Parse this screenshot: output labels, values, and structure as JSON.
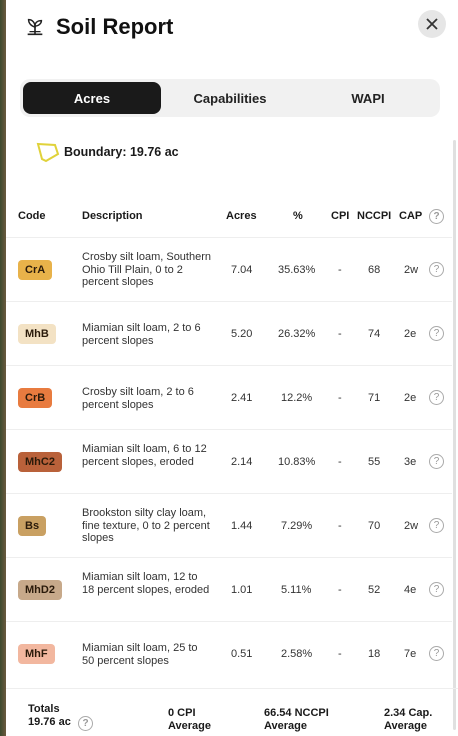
{
  "header": {
    "title": "Soil Report"
  },
  "tabs": [
    {
      "label": "Acres",
      "active": true
    },
    {
      "label": "Capabilities",
      "active": false
    },
    {
      "label": "WAPI",
      "active": false
    }
  ],
  "boundary": {
    "label": "Boundary: 19.76 ac"
  },
  "table": {
    "headers": {
      "code": "Code",
      "description": "Description",
      "acres": "Acres",
      "pct": "%",
      "cpi": "CPI",
      "nccpi": "NCCPI",
      "cap": "CAP"
    },
    "rows": [
      {
        "code": "CrA",
        "color": "#e8b24a",
        "description": "Crosby silt loam, Southern Ohio Till Plain, 0 to 2 percent slopes",
        "acres": "7.04",
        "pct": "35.63%",
        "cpi": "-",
        "nccpi": "68",
        "cap": "2w"
      },
      {
        "code": "MhB",
        "color": "#f3e2c4",
        "description": "Miamian silt loam, 2 to 6 percent slopes",
        "acres": "5.20",
        "pct": "26.32%",
        "cpi": "-",
        "nccpi": "74",
        "cap": "2e"
      },
      {
        "code": "CrB",
        "color": "#e87b3f",
        "description": "Crosby silt loam, 2 to 6 percent slopes",
        "acres": "2.41",
        "pct": "12.2%",
        "cpi": "-",
        "nccpi": "71",
        "cap": "2e"
      },
      {
        "code": "MhC2",
        "color": "#b9613a",
        "description": "Miamian silt loam, 6 to 12 percent slopes, eroded",
        "acres": "2.14",
        "pct": "10.83%",
        "cpi": "-",
        "nccpi": "55",
        "cap": "3e"
      },
      {
        "code": "Bs",
        "color": "#c9a062",
        "description": "Brookston silty clay loam, fine texture, 0 to 2 percent slopes",
        "acres": "1.44",
        "pct": "7.29%",
        "cpi": "-",
        "nccpi": "70",
        "cap": "2w"
      },
      {
        "code": "MhD2",
        "color": "#c7a98a",
        "description": "Miamian silt loam, 12 to 18 percent slopes, eroded",
        "acres": "1.01",
        "pct": "5.11%",
        "cpi": "-",
        "nccpi": "52",
        "cap": "4e"
      },
      {
        "code": "MhF",
        "color": "#f2b79f",
        "description": "Miamian silt loam, 25 to 50 percent slopes",
        "acres": "0.51",
        "pct": "2.58%",
        "cpi": "-",
        "nccpi": "18",
        "cap": "7e"
      }
    ]
  },
  "totals": {
    "label_line1": "Totals",
    "label_line2": "19.76 ac",
    "cpi_line1": "0 CPI",
    "cpi_line2": "Average",
    "nccpi_line1": "66.54 NCCPI",
    "nccpi_line2": "Average",
    "cap_line1": "2.34 Cap.",
    "cap_line2": "Average"
  },
  "icons": {
    "help": "?",
    "close": "close-icon",
    "logo": "seedling-icon",
    "boundary": "polygon-icon"
  },
  "colors": {
    "accent": "#1a1a1a",
    "boundary_stroke": "#e0d23a"
  }
}
